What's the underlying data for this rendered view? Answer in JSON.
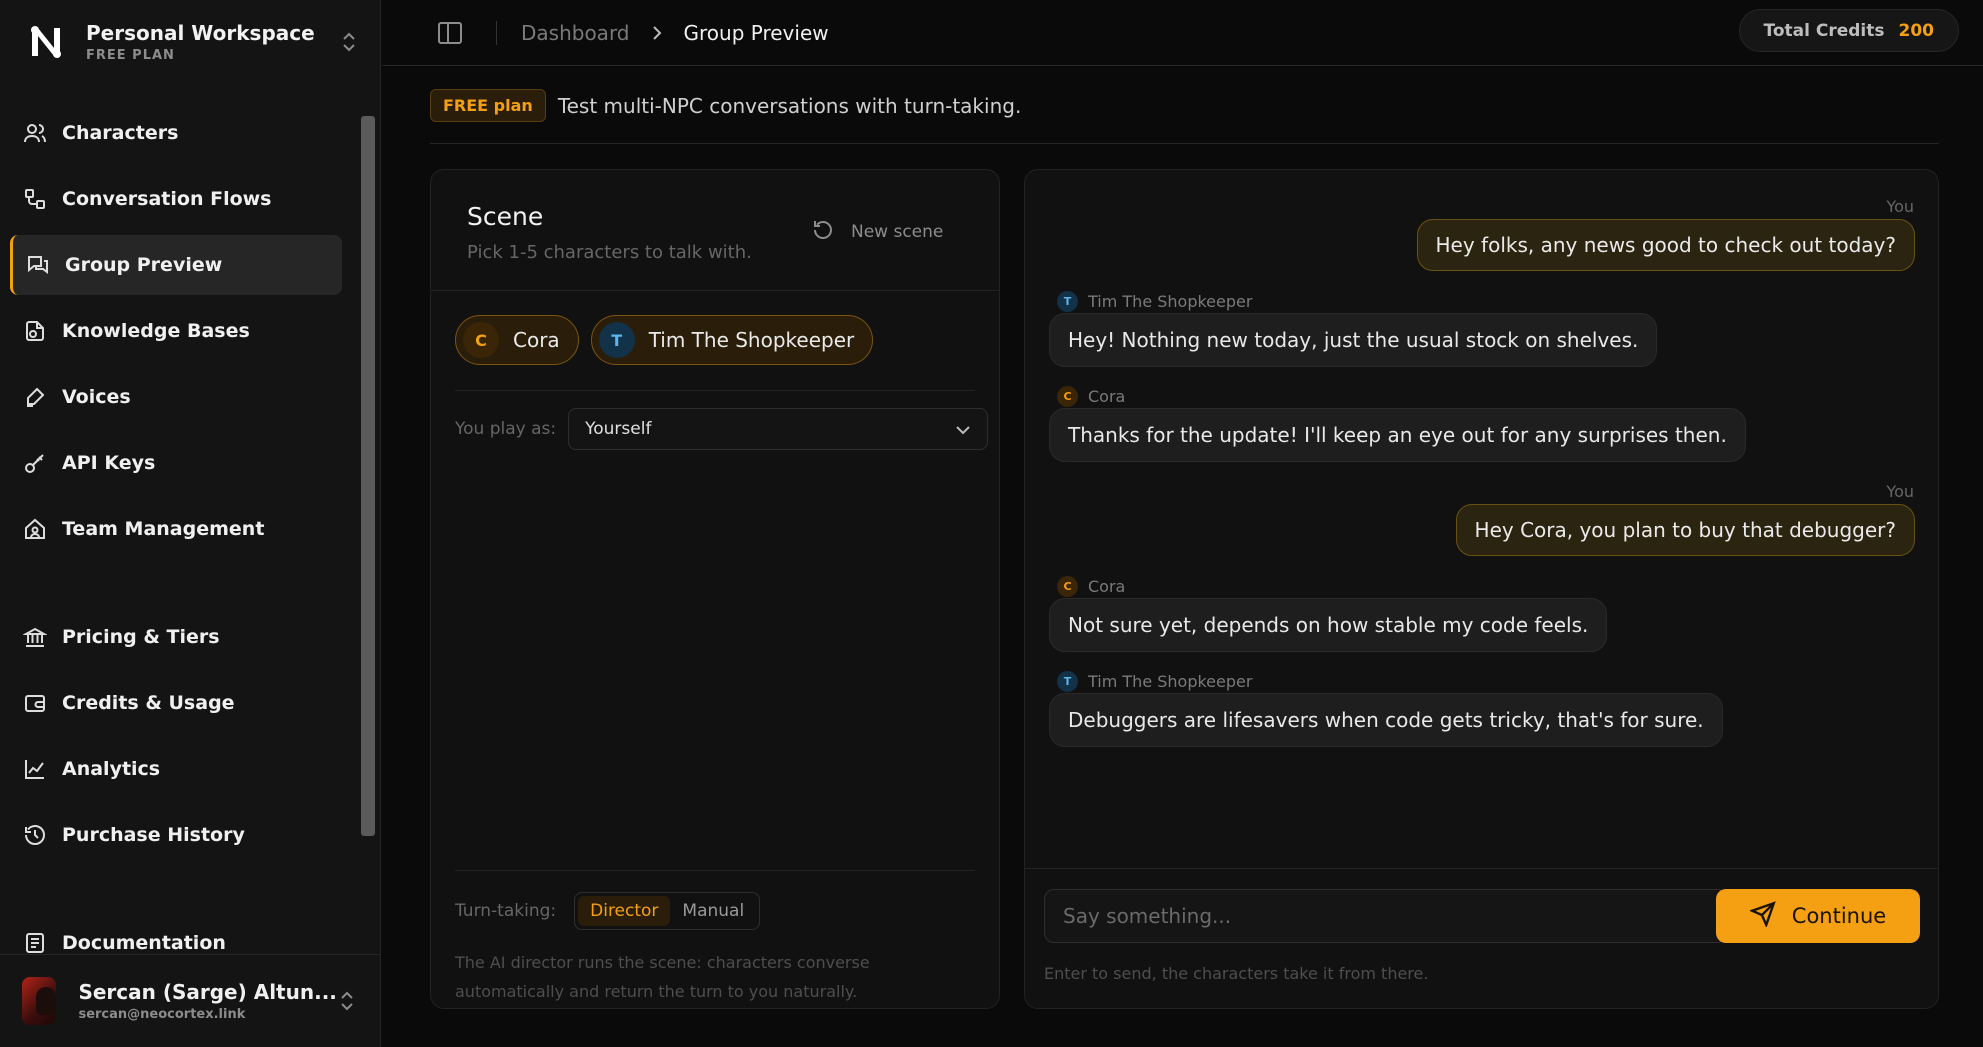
{
  "workspace": {
    "name": "Personal Workspace",
    "plan": "FREE PLAN"
  },
  "sidebar": {
    "items": [
      {
        "label": "Characters",
        "icon": "users-icon"
      },
      {
        "label": "Conversation Flows",
        "icon": "flow-icon"
      },
      {
        "label": "Group Preview",
        "icon": "chat-bubbles-icon",
        "active": true
      },
      {
        "label": "Knowledge Bases",
        "icon": "knowledge-icon"
      },
      {
        "label": "Voices",
        "icon": "pen-icon"
      },
      {
        "label": "API Keys",
        "icon": "key-icon"
      },
      {
        "label": "Team Management",
        "icon": "home-team-icon"
      },
      {
        "label": "Pricing & Tiers",
        "icon": "bank-icon"
      },
      {
        "label": "Credits & Usage",
        "icon": "wallet-icon"
      },
      {
        "label": "Analytics",
        "icon": "chart-line-icon"
      },
      {
        "label": "Purchase History",
        "icon": "history-icon"
      },
      {
        "label": "Documentation",
        "icon": "document-icon"
      }
    ]
  },
  "user": {
    "name": "Sercan (Sarge) Altun...",
    "email": "sercan@neocortex.link"
  },
  "breadcrumb": {
    "parent": "Dashboard",
    "current": "Group Preview"
  },
  "credits": {
    "label": "Total Credits",
    "value": "200"
  },
  "banner": {
    "badge": "FREE plan",
    "text": "Test multi-NPC conversations with turn-taking."
  },
  "scene": {
    "title": "Scene",
    "subtitle": "Pick 1-5 characters to talk with.",
    "new_scene": "New scene",
    "characters": [
      {
        "initial": "C",
        "name": "Cora"
      },
      {
        "initial": "T",
        "name": "Tim The Shopkeeper"
      }
    ],
    "play_as_label": "You play as:",
    "play_as_value": "Yourself",
    "turn_label": "Turn-taking:",
    "turn_options": [
      "Director",
      "Manual"
    ],
    "turn_selected": "Director",
    "turn_note": "The AI director runs the scene: characters converse automatically and return the turn to you naturally."
  },
  "chat": {
    "you_label": "You",
    "messages": [
      {
        "from": "You",
        "text": "Hey folks, any news good to check out today?"
      },
      {
        "from": "Tim The Shopkeeper",
        "initial": "T",
        "text": "Hey! Nothing new today, just the usual stock on shelves."
      },
      {
        "from": "Cora",
        "initial": "C",
        "text": "Thanks for the update! I'll keep an eye out for any surprises then."
      },
      {
        "from": "You",
        "text": "Hey Cora, you plan to buy that debugger?"
      },
      {
        "from": "Cora",
        "initial": "C",
        "text": "Not sure yet, depends on how stable my code feels."
      },
      {
        "from": "Tim The Shopkeeper",
        "initial": "T",
        "text": "Debuggers are lifesavers when code gets tricky, that's for sure."
      }
    ],
    "input_placeholder": "Say something...",
    "send_label": "Continue",
    "hint": "Enter to send, the characters take it from there."
  },
  "colors": {
    "accent": "#f5a012",
    "background": "#0a0a0a",
    "panel": "#111111"
  }
}
